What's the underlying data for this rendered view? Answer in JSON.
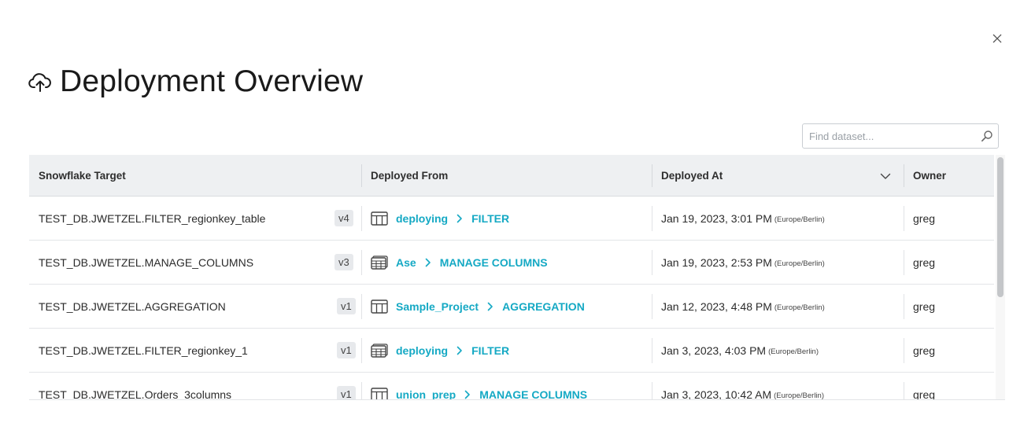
{
  "dialog": {
    "title": "Deployment Overview",
    "close_icon": "close-icon",
    "title_icon": "cloud-upload-icon"
  },
  "search": {
    "placeholder": "Find dataset...",
    "value": "",
    "icon": "search-icon"
  },
  "table": {
    "columns": {
      "target": "Snowflake Target",
      "from": "Deployed From",
      "at": "Deployed At",
      "owner": "Owner"
    },
    "sort_column": "at",
    "sort_icon": "chevron-down-icon",
    "rows": [
      {
        "target": "TEST_DB.JWETZEL.FILTER_regionkey_table",
        "version": "v4",
        "dataset_icon": "table-icon",
        "project": "deploying",
        "recipe": "FILTER",
        "date": "Jan 19, 2023, 3:01 PM",
        "tz": "(Europe/Berlin)",
        "owner": "greg"
      },
      {
        "target": "TEST_DB.JWETZEL.MANAGE_COLUMNS",
        "version": "v3",
        "dataset_icon": "stacked-table-icon",
        "project": "Ase",
        "recipe": "MANAGE COLUMNS",
        "date": "Jan 19, 2023, 2:53 PM",
        "tz": "(Europe/Berlin)",
        "owner": "greg"
      },
      {
        "target": "TEST_DB.JWETZEL.AGGREGATION",
        "version": "v1",
        "dataset_icon": "table-icon",
        "project": "Sample_Project",
        "recipe": "AGGREGATION",
        "date": "Jan 12, 2023, 4:48 PM",
        "tz": "(Europe/Berlin)",
        "owner": "greg"
      },
      {
        "target": "TEST_DB.JWETZEL.FILTER_regionkey_1",
        "version": "v1",
        "dataset_icon": "stacked-table-icon",
        "project": "deploying",
        "recipe": "FILTER",
        "date": "Jan 3, 2023, 4:03 PM",
        "tz": "(Europe/Berlin)",
        "owner": "greg"
      },
      {
        "target": "TEST_DB.JWETZEL.Orders_3columns",
        "version": "v1",
        "dataset_icon": "table-icon",
        "project": "union_prep",
        "recipe": "MANAGE COLUMNS",
        "date": "Jan 3, 2023, 10:42 AM",
        "tz": "(Europe/Berlin)",
        "owner": "greg"
      }
    ]
  },
  "colors": {
    "link": "#15a9c4",
    "header_bg": "#eef0f2",
    "scroll_thumb": "#c4c6c9"
  }
}
